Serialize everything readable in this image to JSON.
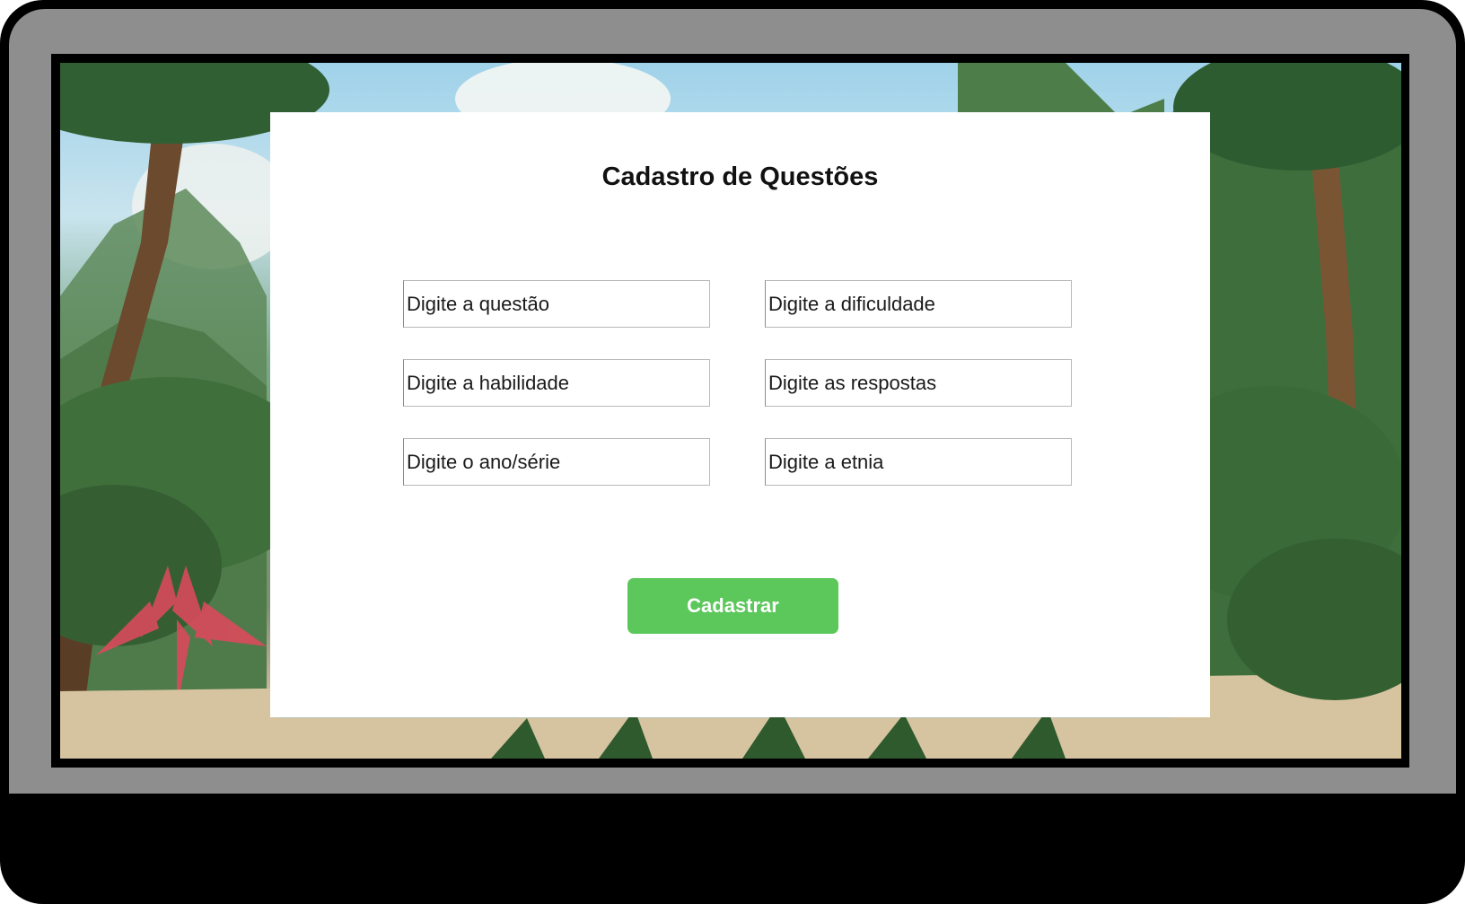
{
  "app": {
    "background": "tropical-jungle-beach-illustration",
    "accent_color": "#5cc75a"
  },
  "form": {
    "title": "Cadastro de Questões",
    "fields": {
      "questao": {
        "placeholder": "Digite a questão",
        "value": ""
      },
      "dificuldade": {
        "placeholder": "Digite a dificuldade",
        "value": ""
      },
      "habilidade": {
        "placeholder": "Digite a habilidade",
        "value": ""
      },
      "respostas": {
        "placeholder": "Digite as respostas",
        "value": ""
      },
      "ano_serie": {
        "placeholder": "Digite o ano/série",
        "value": ""
      },
      "etnia": {
        "placeholder": "Digite a etnia",
        "value": ""
      }
    },
    "submit_label": "Cadastrar"
  }
}
